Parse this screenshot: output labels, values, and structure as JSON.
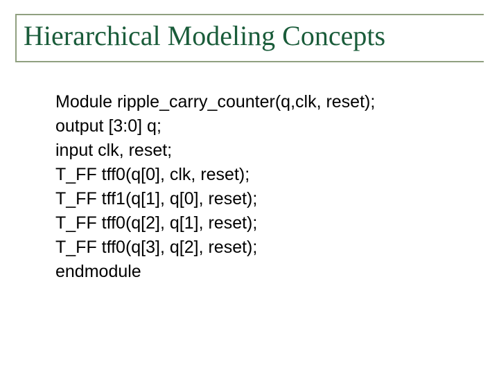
{
  "title": "Hierarchical Modeling Concepts",
  "code": {
    "l0": "Module ripple_carry_counter(q,clk, reset);",
    "l1": "output [3:0] q;",
    "l2": "input clk, reset;",
    "l3": "T_FF tff0(q[0], clk, reset);",
    "l4": "T_FF tff1(q[1], q[0], reset);",
    "l5": "T_FF tff0(q[2], q[1], reset);",
    "l6": "T_FF tff0(q[3], q[2], reset);",
    "l7": "endmodule"
  }
}
